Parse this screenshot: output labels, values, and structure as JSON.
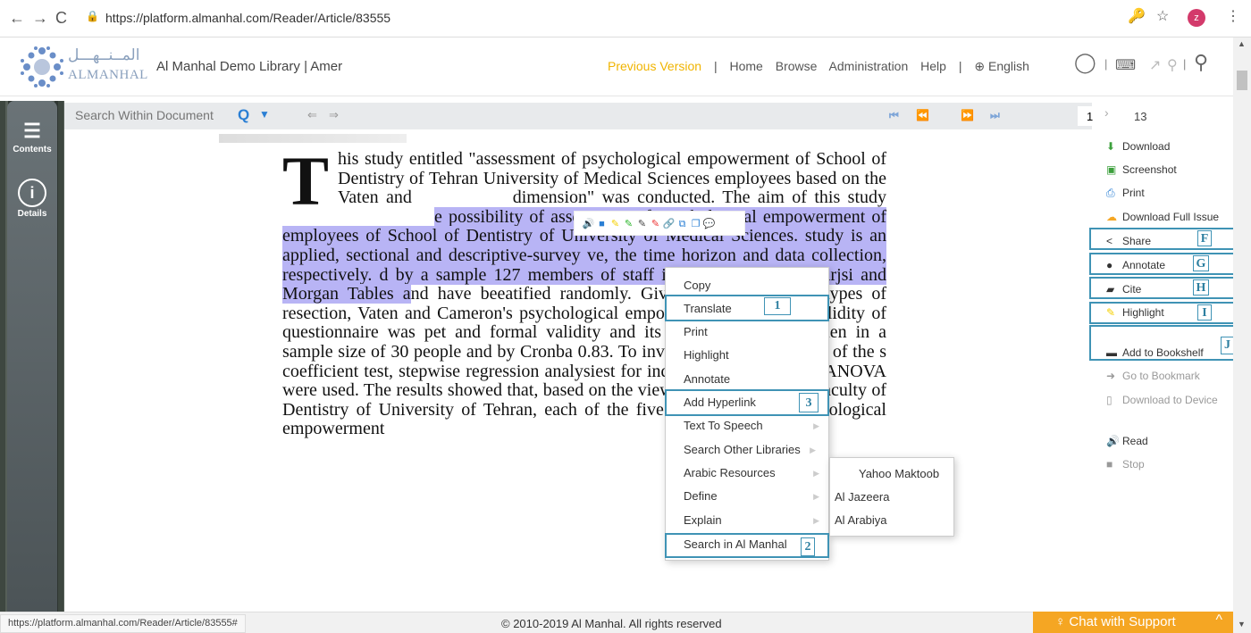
{
  "browser": {
    "back": "←",
    "forward": "→",
    "reload": "C",
    "lock": "🔒",
    "url": "https://platform.almanhal.com/Reader/Article/83555",
    "key_icon": "🔑",
    "star_icon": "☆",
    "avatar": "z",
    "menu_icon": "⋮"
  },
  "header": {
    "logo_ar": "المــنــهـــل",
    "logo_en": "ALMANHAL",
    "library": "Al Manhal Demo Library | Amer",
    "nav": [
      "Previous Version",
      "|",
      "Home",
      "Browse",
      "Administration",
      "Help",
      "|",
      "⊕ English"
    ],
    "account_icon": "◯",
    "keyboard_icon": "⌨",
    "share_icon": "↗",
    "search_icon": "⚲"
  },
  "sidebar": {
    "contents_label": "Contents",
    "details_label": "Details"
  },
  "toolbar": {
    "search_placeholder": "Search Within Document",
    "page_value": "1",
    "page_total": "13"
  },
  "document": {
    "drop_cap": "T",
    "p1": "his study entitled \"assessment of psychological empowerment of School of Dentistry of Tehran University of Medical Sciences employees based on the Vaten and ",
    "p1b": " dimension\" was conducted. The aim of this study ",
    "hl_start": "e possibility of assessment of psychological empowerment of employees of School of Dentistry of University of Medical Sciences. ",
    "hl_mid": " study is an applied, sectional and descriptive-survey ",
    "hl_mid2": "ve, the time horizon and data collection, respectively. ",
    "hl_mid3": "d by a sample 127 members of staff in the Schoo",
    "hl_mid4": " using Karjsi and Morgan Tables a",
    "p2": "nd have bee",
    "p3": "atified randomly. Given the purpose and types of res",
    "p4": "ection, Vaten and Cameron's psychological empowe",
    "p5": "e was used, and validity of questionnaire was pe",
    "p6": "t and formal validity and its reliability by implemen",
    "p7": " in a sample size of 30 people and by Cronba",
    "p8": " 0.83. To investigate the hypothesis of the s",
    "p9": " coefficient test, stepwise regression analysi",
    "p10": "est for independent groups and ANOVA were used. The results showed that, based on the views of the staff of the Faculty of Dentistry of University of Tehran, each of the five components of psychological empowerment"
  },
  "context_menu": {
    "items": [
      "Copy",
      "Translate",
      "Print",
      "Highlight",
      "Annotate",
      "Add Hyperlink",
      "Text To Speech",
      "Search Other Libraries",
      "Arabic Resources",
      "Define",
      "Explain",
      "Search in Al Manhal"
    ],
    "submenu": [
      "Yahoo Maktoob",
      "Al Jazeera",
      "Al Arabiya"
    ]
  },
  "callouts": {
    "n1": "1",
    "n2": "2",
    "n3": "3",
    "F": "F",
    "G": "G",
    "H": "H",
    "I": "I",
    "J": "J"
  },
  "right_panel": {
    "download": "Download",
    "screenshot": "Screenshot",
    "print": "Print",
    "download_full": "Download Full Issue",
    "share": "Share",
    "annotate": "Annotate",
    "cite": "Cite",
    "highlight": "Highlight",
    "add_bookshelf": "Add to Bookshelf",
    "go_bookmark": "Go to Bookmark",
    "download_device": "Download to Device",
    "read": "Read",
    "stop": "Stop"
  },
  "footer": {
    "status_url": "https://platform.almanhal.com/Reader/Article/83555#",
    "copyright": "© 2010-2019 Al Manhal. All rights reserved",
    "chat": "♀ Chat with Support",
    "chat_caret": "^"
  },
  "colors": {
    "accent": "#2a7fd4",
    "highlight": "#b8b4f5",
    "callout": "#3f93b5",
    "chat": "#f5a623",
    "prev_version": "#f0b400"
  }
}
